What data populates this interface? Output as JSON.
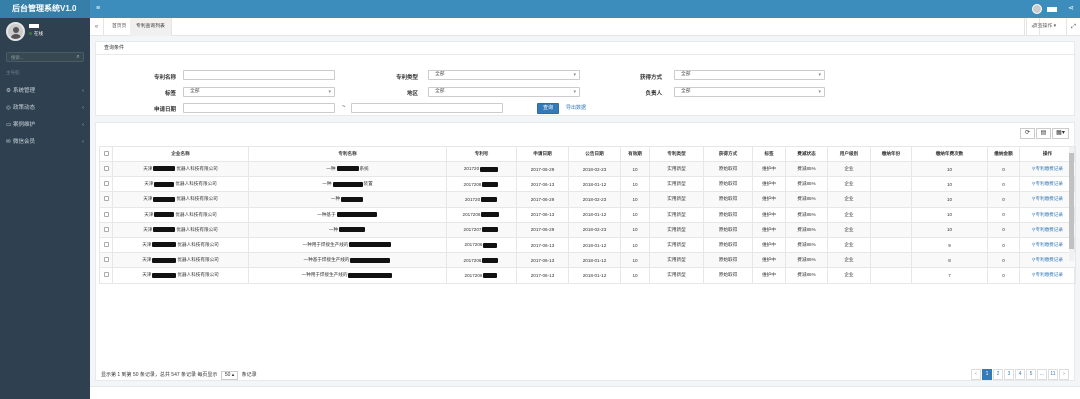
{
  "app": {
    "title": "后台管理系统V1.0"
  },
  "user": {
    "status": "在线"
  },
  "search": {
    "placeholder": "搜索..."
  },
  "sidebar": {
    "section": "主导航",
    "items": [
      {
        "label": "系统管理",
        "icon": "gear-icon"
      },
      {
        "label": "政策动态",
        "icon": "globe-icon"
      },
      {
        "label": "案例维护",
        "icon": "card-icon"
      },
      {
        "label": "微信会员",
        "icon": "wechat-icon"
      }
    ]
  },
  "tabs": {
    "items": [
      "首页页",
      "专利查询列表"
    ],
    "ops_label": "页签操作"
  },
  "query": {
    "title": "查询条件",
    "labels": {
      "name": "专利名称",
      "ptype": "专利类型",
      "method": "获得方式",
      "tag": "标签",
      "area": "地区",
      "owner": "负责人",
      "date": "申请日期"
    },
    "all": "全部",
    "date_sep": "~",
    "btn_query": "查询",
    "btn_export": "导出数据"
  },
  "table": {
    "headers": [
      "企业名称",
      "专利名称",
      "专利号",
      "申请日期",
      "公告日期",
      "有效期",
      "专利类型",
      "获得方式",
      "标签",
      "费减状态",
      "用户级别",
      "缴纳年份",
      "缴纳年费次数",
      "缴纳金额",
      "操作"
    ],
    "rows": [
      {
        "company": [
          "天津",
          "优器人科技有限公司"
        ],
        "patent": [
          "一种",
          "系统"
        ],
        "no": "201720",
        "apply": "2017-06-29",
        "publish": "2018-02-23",
        "valid": "10",
        "ptype": "实用新型",
        "method": "原始取得",
        "tag": "维护中",
        "fee": "费减85%",
        "level": "企业",
        "year": "",
        "times": "10",
        "amount": "0",
        "op": "专利缴费记录"
      },
      {
        "company": [
          "天津",
          "优器人科技有限公司"
        ],
        "patent": [
          "一种",
          "装置"
        ],
        "no": "2017206",
        "apply": "2017-06-13",
        "publish": "2018-01-12",
        "valid": "10",
        "ptype": "实用新型",
        "method": "原始取得",
        "tag": "维护中",
        "fee": "费减85%",
        "level": "企业",
        "year": "",
        "times": "10",
        "amount": "0",
        "op": "专利缴费记录"
      },
      {
        "company": [
          "天津",
          "优器人科技有限公司"
        ],
        "patent": [
          "一种",
          ""
        ],
        "no": "201720",
        "apply": "2017-06-29",
        "publish": "2018-02-23",
        "valid": "10",
        "ptype": "实用新型",
        "method": "原始取得",
        "tag": "维护中",
        "fee": "费减85%",
        "level": "企业",
        "year": "",
        "times": "10",
        "amount": "0",
        "op": "专利缴费记录"
      },
      {
        "company": [
          "天津",
          "优器人科技有限公司"
        ],
        "patent": [
          "一种基于",
          ""
        ],
        "no": "2017206",
        "apply": "2017-06-13",
        "publish": "2018-01-12",
        "valid": "10",
        "ptype": "实用新型",
        "method": "原始取得",
        "tag": "维护中",
        "fee": "费减85%",
        "level": "企业",
        "year": "",
        "times": "10",
        "amount": "0",
        "op": "专利缴费记录"
      },
      {
        "company": [
          "天津",
          "优器人科技有限公司"
        ],
        "patent": [
          "一种",
          ""
        ],
        "no": "2017207",
        "apply": "2017-06-29",
        "publish": "2018-02-23",
        "valid": "10",
        "ptype": "实用新型",
        "method": "原始取得",
        "tag": "维护中",
        "fee": "费减85%",
        "level": "企业",
        "year": "",
        "times": "10",
        "amount": "0",
        "op": "专利缴费记录"
      },
      {
        "company": [
          "天津",
          "优器人科技有限公司"
        ],
        "patent": [
          "一种用于焊接生产线的",
          ""
        ],
        "no": "2017206",
        "apply": "2017-06-13",
        "publish": "2018-01-12",
        "valid": "10",
        "ptype": "实用新型",
        "method": "原始取得",
        "tag": "维护中",
        "fee": "费减85%",
        "level": "企业",
        "year": "",
        "times": "9",
        "amount": "0",
        "op": "专利缴费记录"
      },
      {
        "company": [
          "天津",
          "优器人科技有限公司"
        ],
        "patent": [
          "一种基于焊接生产线的",
          ""
        ],
        "no": "2017206",
        "apply": "2017-06-13",
        "publish": "2018-01-12",
        "valid": "10",
        "ptype": "实用新型",
        "method": "原始取得",
        "tag": "维护中",
        "fee": "费减85%",
        "level": "企业",
        "year": "",
        "times": "8",
        "amount": "0",
        "op": "专利缴费记录"
      },
      {
        "company": [
          "天津",
          "优器人科技有限公司"
        ],
        "patent": [
          "一种用于焊接生产线的",
          ""
        ],
        "no": "2017206",
        "apply": "2017-06-13",
        "publish": "2018-01-12",
        "valid": "10",
        "ptype": "实用新型",
        "method": "原始取得",
        "tag": "维护中",
        "fee": "费减85%",
        "level": "企业",
        "year": "",
        "times": "7",
        "amount": "0",
        "op": "专利缴费记录"
      }
    ]
  },
  "pagination": {
    "info_a": "显示第 1 到第 50 条记录，总共 547 条记录 每页显示",
    "page_size": "50",
    "info_b": "条记录",
    "pages": [
      "‹",
      "1",
      "2",
      "3",
      "4",
      "5",
      "...",
      "11",
      "›"
    ]
  }
}
